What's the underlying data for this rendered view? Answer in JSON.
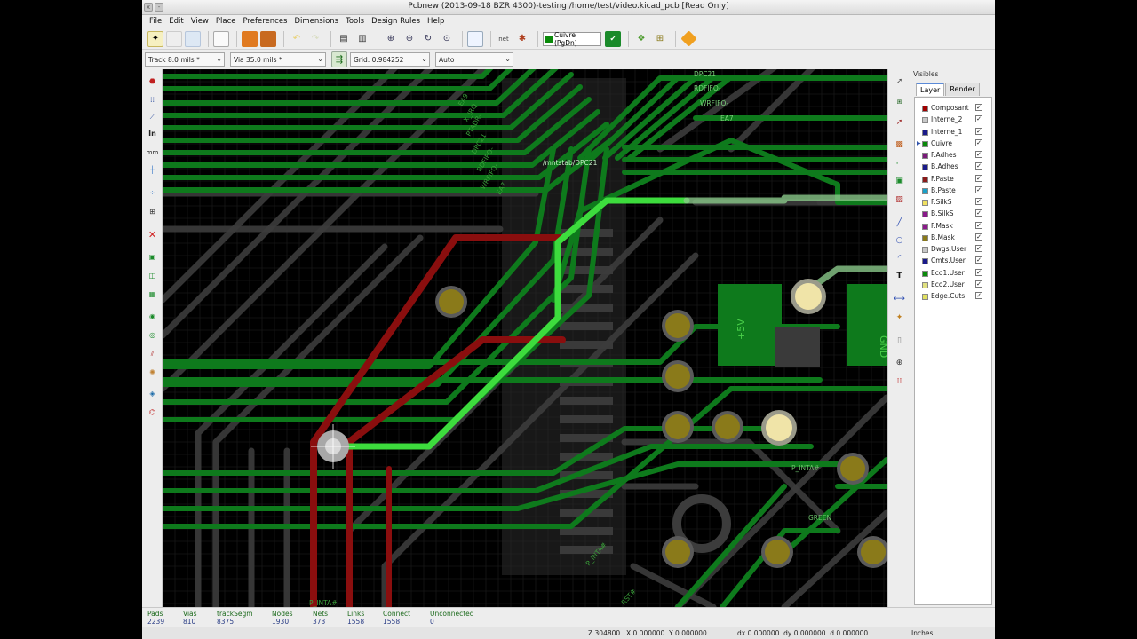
{
  "window": {
    "title": "Pcbnew (2013-09-18 BZR 4300)-testing /home/test/video.kicad_pcb [Read Only]"
  },
  "menu": [
    "File",
    "Edit",
    "View",
    "Place",
    "Preferences",
    "Dimensions",
    "Tools",
    "Design Rules",
    "Help"
  ],
  "toolbar": {
    "layer_select": "Cuivre (PgDn)",
    "track_width": "Track 8.0 mils *",
    "via_size": "Via 35.0 mils *",
    "grid": "Grid: 0.984252",
    "zoom": "Auto"
  },
  "visibles": {
    "title": "Visibles",
    "tabs": [
      "Layer",
      "Render"
    ],
    "layers": [
      {
        "name": "Composant",
        "color": "#a00000",
        "active": false
      },
      {
        "name": "Interne_2",
        "color": "#c8c8c8",
        "active": false
      },
      {
        "name": "Interne_1",
        "color": "#1a1a8a",
        "active": false
      },
      {
        "name": "Cuivre",
        "color": "#0a8a0a",
        "active": true
      },
      {
        "name": "F.Adhes",
        "color": "#7a1a7a",
        "active": false
      },
      {
        "name": "B.Adhes",
        "color": "#1a1a8a",
        "active": false
      },
      {
        "name": "F.Paste",
        "color": "#8a1a1a",
        "active": false
      },
      {
        "name": "B.Paste",
        "color": "#1aa0c8",
        "active": false
      },
      {
        "name": "F.SilkS",
        "color": "#f0e060",
        "active": false
      },
      {
        "name": "B.SilkS",
        "color": "#8a1a8a",
        "active": false
      },
      {
        "name": "F.Mask",
        "color": "#8a1a8a",
        "active": false
      },
      {
        "name": "B.Mask",
        "color": "#8a7a1a",
        "active": false
      },
      {
        "name": "Dwgs.User",
        "color": "#c8c8c8",
        "active": false
      },
      {
        "name": "Cmts.User",
        "color": "#1a1a8a",
        "active": false
      },
      {
        "name": "Eco1.User",
        "color": "#0a8a0a",
        "active": false
      },
      {
        "name": "Eco2.User",
        "color": "#e0e080",
        "active": false
      },
      {
        "name": "Edge.Cuts",
        "color": "#e0e060",
        "active": false
      }
    ]
  },
  "board": {
    "labels": [
      "DPC21",
      "RDFIFO-",
      "WRFIFO-",
      "EA7",
      "EA9",
      "X_IRQ",
      "PTADR-",
      "DPC21",
      "RDFIFO-",
      "WRFIFO-",
      "EA7",
      "/mntstab/DPC21",
      "+5V",
      "GND",
      "P_INTA#",
      "GREEN",
      "P_INTA#",
      "P_INTA#",
      "RST#"
    ],
    "colors": {
      "bg": "#000000",
      "copper_front": "#0e7a1c",
      "copper_bright": "#3ddc3d",
      "copper_back": "#8a0e0e",
      "pad": "#8a7a1a",
      "grid": "#1e1e1e"
    }
  },
  "status": {
    "items": [
      {
        "label": "Pads",
        "value": "2239"
      },
      {
        "label": "Vias",
        "value": "810"
      },
      {
        "label": "trackSegm",
        "value": "8375"
      },
      {
        "label": "Nodes",
        "value": "1930"
      },
      {
        "label": "Nets",
        "value": "373"
      },
      {
        "label": "Links",
        "value": "1558"
      },
      {
        "label": "Connect",
        "value": "1558"
      },
      {
        "label": "Unconnected",
        "value": "0"
      }
    ],
    "zoom": "Z 304800",
    "xy": "X 0.000000  Y 0.000000",
    "delta": "dx 0.000000  dy 0.000000  d 0.000000",
    "units": "Inches"
  }
}
